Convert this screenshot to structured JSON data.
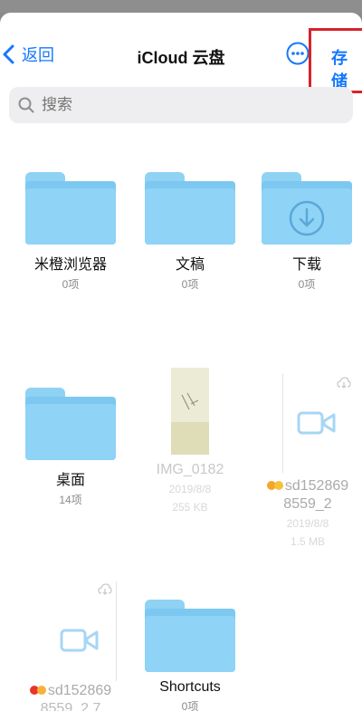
{
  "nav": {
    "back_label": "返回",
    "title": "iCloud 云盘",
    "save_label": "存储"
  },
  "search": {
    "placeholder": "搜索"
  },
  "items": [
    {
      "name": "米橙浏览器",
      "sub": "0项"
    },
    {
      "name": "文稿",
      "sub": "0项"
    },
    {
      "name": "下载",
      "sub": "0项"
    },
    {
      "name": "桌面",
      "sub": "14项"
    },
    {
      "name": "IMG_0182",
      "sub1": "2019/8/8",
      "sub2": "255 KB"
    },
    {
      "name": "sd152869",
      "name2": "8559_2",
      "sub1": "2019/8/8",
      "sub2": "1.5 MB"
    },
    {
      "name": "sd152869",
      "name2": "8559_2.7"
    },
    {
      "name": "Shortcuts",
      "sub": "0项"
    }
  ],
  "colors": {
    "accent": "#1677ff",
    "folder": "#8fd3f6",
    "highlight_box": "#d9222a"
  }
}
